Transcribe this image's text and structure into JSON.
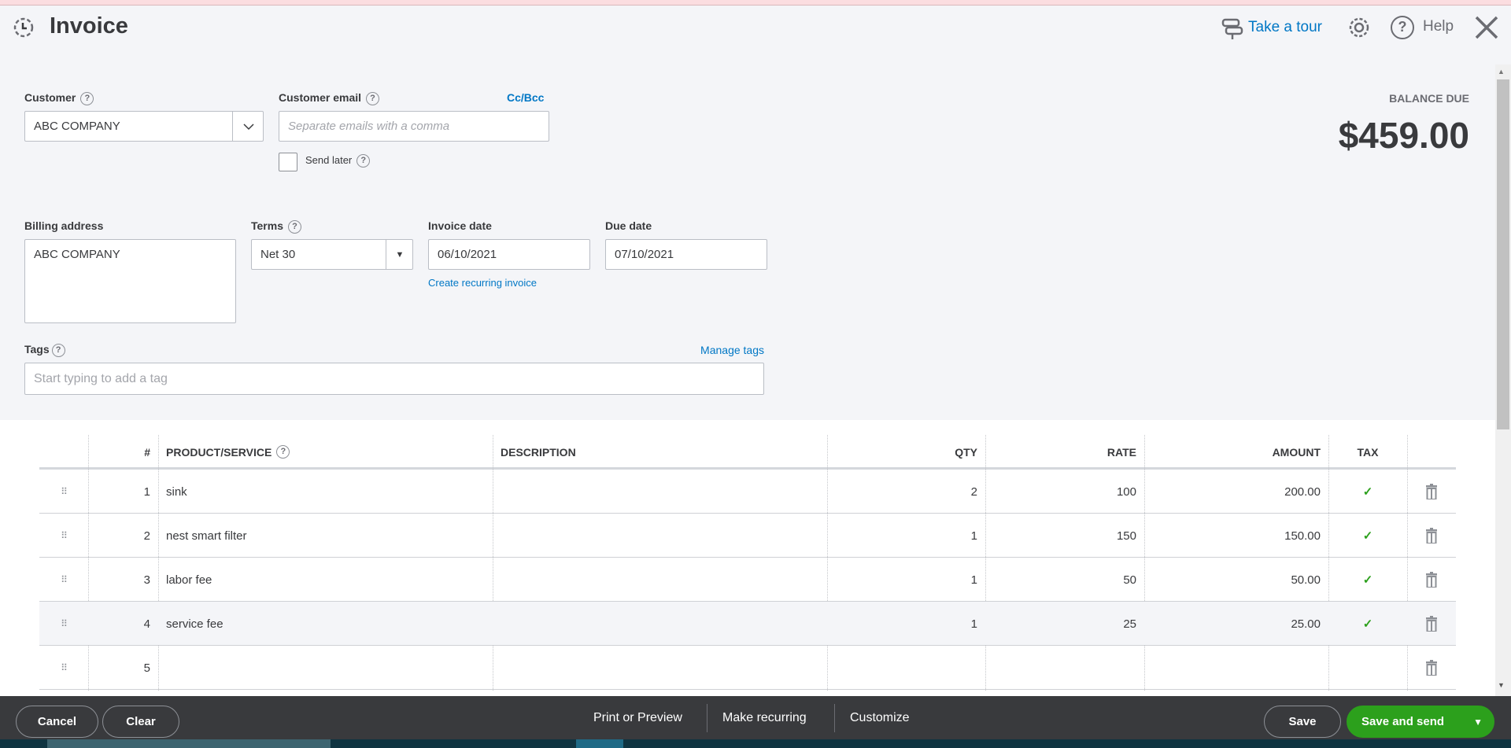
{
  "header": {
    "title": "Invoice",
    "tour": "Take a tour",
    "help": "Help"
  },
  "customer": {
    "label": "Customer",
    "value": "ABC COMPANY"
  },
  "email": {
    "label": "Customer email",
    "placeholder": "Separate emails with a comma",
    "ccbcc": "Cc/Bcc",
    "send_later": "Send later"
  },
  "balance": {
    "label": "BALANCE DUE",
    "amount": "$459.00"
  },
  "billing": {
    "label": "Billing address",
    "value": "ABC COMPANY"
  },
  "terms": {
    "label": "Terms",
    "value": "Net 30"
  },
  "invoice_date": {
    "label": "Invoice date",
    "value": "06/10/2021",
    "recurring": "Create recurring invoice"
  },
  "due_date": {
    "label": "Due date",
    "value": "07/10/2021"
  },
  "tags": {
    "label": "Tags",
    "manage": "Manage tags",
    "placeholder": "Start typing to add a tag"
  },
  "table": {
    "headers": {
      "num": "#",
      "product": "PRODUCT/SERVICE",
      "description": "DESCRIPTION",
      "qty": "QTY",
      "rate": "RATE",
      "amount": "AMOUNT",
      "tax": "TAX"
    },
    "rows": [
      {
        "num": "1",
        "product": "sink",
        "description": "",
        "qty": "2",
        "rate": "100",
        "amount": "200.00",
        "tax": true
      },
      {
        "num": "2",
        "product": "nest smart filter",
        "description": "",
        "qty": "1",
        "rate": "150",
        "amount": "150.00",
        "tax": true
      },
      {
        "num": "3",
        "product": "labor fee",
        "description": "",
        "qty": "1",
        "rate": "50",
        "amount": "50.00",
        "tax": true
      },
      {
        "num": "4",
        "product": "service fee",
        "description": "",
        "qty": "1",
        "rate": "25",
        "amount": "25.00",
        "tax": true
      },
      {
        "num": "5",
        "product": "",
        "description": "",
        "qty": "",
        "rate": "",
        "amount": "",
        "tax": false
      }
    ]
  },
  "footer": {
    "cancel": "Cancel",
    "clear": "Clear",
    "print": "Print or Preview",
    "recurring": "Make recurring",
    "customize": "Customize",
    "save": "Save",
    "save_send": "Save and send"
  },
  "colors": {
    "accent": "#0077c5",
    "green": "#2ca01c",
    "footer": "#393a3d"
  }
}
